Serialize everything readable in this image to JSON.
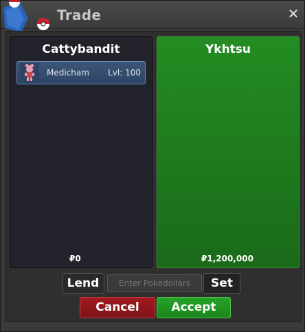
{
  "window": {
    "title": "Trade"
  },
  "left_panel": {
    "player_name": "Cattybandit",
    "items": [
      {
        "name": "Medicham",
        "level": "Lvl: 100"
      }
    ],
    "money": "₽0"
  },
  "right_panel": {
    "player_name": "Ykhtsu",
    "money": "₽1,200,000"
  },
  "controls": {
    "lend_label": "Lend",
    "pokedollars_placeholder": "Enter Pokedollars",
    "set_label": "Set",
    "cancel_label": "Cancel",
    "accept_label": "Accept"
  },
  "colors": {
    "accept_green": "#1f9a20",
    "cancel_red": "#9a171c",
    "offer_panel_green": "#238c22",
    "item_blue": "#3d5577"
  }
}
